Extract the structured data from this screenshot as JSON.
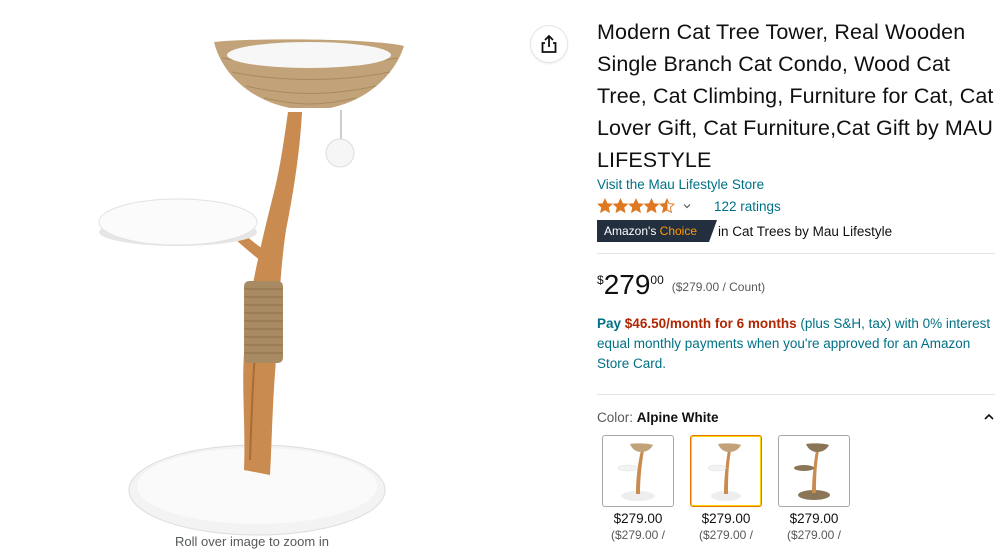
{
  "product": {
    "title": "Modern Cat Tree Tower, Real Wooden Single Branch Cat Condo, Wood Cat Tree, Cat Climbing, Furniture for Cat, Cat Lover Gift, Cat Furniture,Cat Gift by MAU LIFESTYLE",
    "store_link": "Visit the Mau Lifestyle Store",
    "rating": 4.5,
    "ratings_count": "122 ratings",
    "badge": {
      "prefix": "Amazon's",
      "highlight": "Choice"
    },
    "badge_category": {
      "prefix": "in",
      "category": "Cat Trees",
      "suffix": "by Mau Lifestyle"
    },
    "price": {
      "symbol": "$",
      "whole": "279",
      "fraction": "00",
      "unit": "($279.00 / Count)"
    },
    "financing": {
      "pay": "Pay",
      "amount": "$46.50/month for 6 months",
      "rest": "(plus S&H, tax) with 0% interest equal monthly payments when you're approved for an Amazon Store Card."
    },
    "color": {
      "label": "Color:",
      "value": "Alpine White"
    },
    "swatches": [
      {
        "price": "$279.00",
        "unit": "($279.00 /"
      },
      {
        "price": "$279.00",
        "unit": "($279.00 /"
      },
      {
        "price": "$279.00",
        "unit": "($279.00 /"
      }
    ],
    "selected_swatch": 1
  },
  "image": {
    "zoom_hint": "Roll over image to zoom in"
  },
  "icons": {
    "share": "share-icon",
    "chevron": "chevron-down-icon",
    "collapse": "chevron-up-icon",
    "star": "star-icon"
  },
  "colors": {
    "link": "#007185",
    "price_red": "#b12704",
    "star": "#de7921",
    "badge_bg": "#232f3e",
    "badge_orange": "#ff9900",
    "selected_border": "#e77600"
  }
}
